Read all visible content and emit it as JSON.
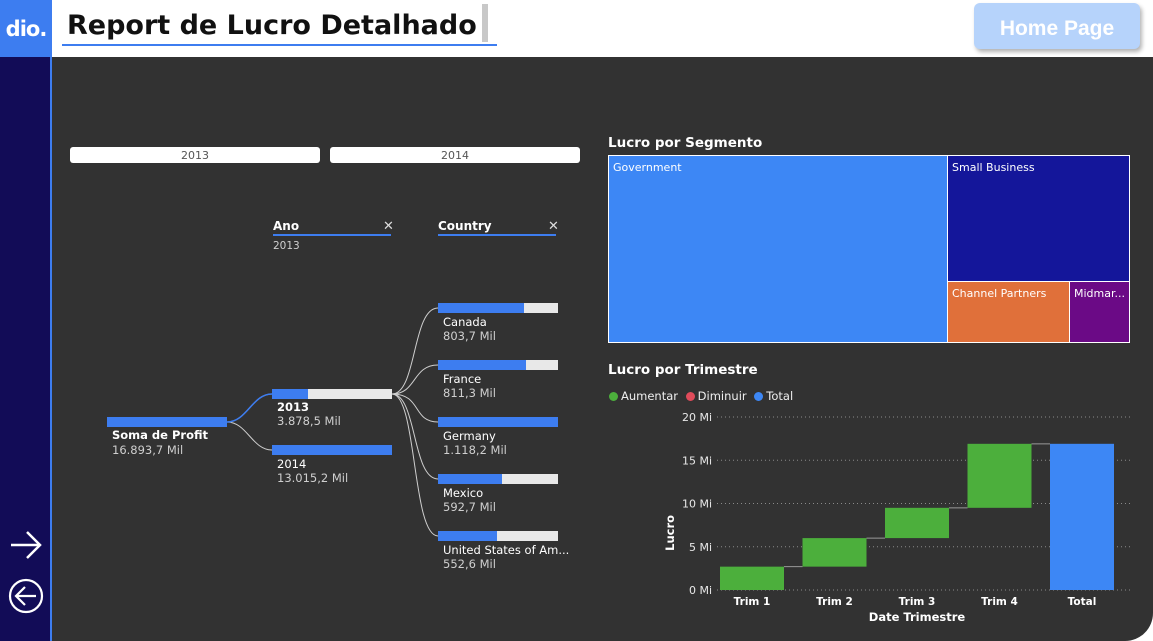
{
  "logo": {
    "text": "dio."
  },
  "header": {
    "title": "Report de Lucro Detalhado",
    "home_button": "Home Page"
  },
  "nav": {
    "forward_icon": "arrow-right-icon",
    "back_icon": "circle-arrow-left-icon"
  },
  "slicer": {
    "options": [
      "2013",
      "2014"
    ]
  },
  "decomposition": {
    "headers": [
      {
        "label": "Ano",
        "selected": "2013"
      },
      {
        "label": "Country",
        "selected": ""
      }
    ],
    "root": {
      "label": "Soma de Profit",
      "value": "16.893,7 Mil"
    },
    "years": [
      {
        "label": "2013",
        "value": "3.878,5 Mil",
        "fill": 0.3
      },
      {
        "label": "2014",
        "value": "13.015,2 Mil",
        "fill": 1.0
      }
    ],
    "countries": [
      {
        "label": "Canada",
        "value": "803,7 Mil",
        "fill": 0.72
      },
      {
        "label": "France",
        "value": "811,3 Mil",
        "fill": 0.73
      },
      {
        "label": "Germany",
        "value": "1.118,2 Mil",
        "fill": 1.0
      },
      {
        "label": "Mexico",
        "value": "592,7 Mil",
        "fill": 0.53
      },
      {
        "label": "United States of Am...",
        "value": "552,6 Mil",
        "fill": 0.49
      }
    ],
    "close_icon": "close-icon"
  },
  "treemap": {
    "title": "Lucro por Segmento",
    "segments": [
      {
        "label": "Government",
        "color": "#3d87f5"
      },
      {
        "label": "Small Business",
        "color": "#14169a"
      },
      {
        "label": "Channel Partners",
        "color": "#e0703a"
      },
      {
        "label": "Midmar...",
        "color": "#6b0a86"
      }
    ]
  },
  "colors": {
    "accent": "#3d7df0",
    "increase": "#4caf3c",
    "decrease": "#e04b5a",
    "total": "#3d87f5"
  },
  "chart_data": {
    "type": "bar",
    "subtype": "waterfall",
    "title": "Lucro por Trimestre",
    "legend": [
      "Aumentar",
      "Diminuir",
      "Total"
    ],
    "legend_position": "top-left",
    "categories": [
      "Trim 1",
      "Trim 2",
      "Trim 3",
      "Trim 4",
      "Total"
    ],
    "increments": [
      2.7,
      3.3,
      3.5,
      7.4
    ],
    "total": 16.9,
    "xlabel": "Date Trimestre",
    "ylabel": "Lucro",
    "ylim": [
      0,
      20
    ],
    "yticks": [
      "0 Mi",
      "5 Mi",
      "10 Mi",
      "15 Mi",
      "20 Mi"
    ],
    "yticks_values": [
      0,
      5,
      10,
      15,
      20
    ],
    "grid": true
  }
}
